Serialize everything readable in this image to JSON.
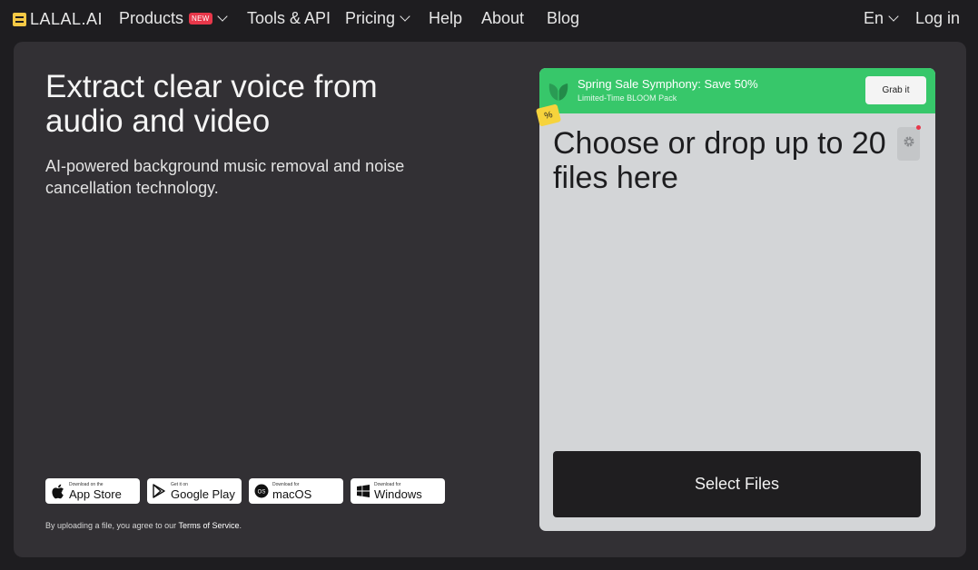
{
  "brand": {
    "name": "LALAL.AI"
  },
  "nav": {
    "products": "Products",
    "products_badge": "NEW",
    "tools": "Tools & API",
    "pricing": "Pricing",
    "help": "Help",
    "about": "About",
    "blog": "Blog",
    "language": "En",
    "login": "Log in"
  },
  "hero": {
    "title": "Extract clear voice from audio and video",
    "subtitle": "AI-powered background music removal and noise cancellation technology."
  },
  "stores": [
    {
      "small": "Download on the",
      "big": "App Store",
      "icon": "apple-icon"
    },
    {
      "small": "Get it on",
      "big": "Google Play",
      "icon": "google-play-icon"
    },
    {
      "small": "Download for",
      "big": "macOS",
      "icon": "macos-icon"
    },
    {
      "small": "Download for",
      "big": "Windows",
      "icon": "windows-icon"
    }
  ],
  "terms": {
    "prefix": "By uploading a file, you agree to our ",
    "link": "Terms of Service",
    "suffix": "."
  },
  "promo": {
    "badge": "%",
    "title": "Spring Sale Symphony: Save 50%",
    "subtitle": "Limited-Time BLOOM Pack",
    "button": "Grab it"
  },
  "upload": {
    "title": "Choose or drop up to 20 files here",
    "button": "Select Files"
  },
  "colors": {
    "background": "#1e1d20",
    "card": "#323034",
    "promo_green": "#37c76a",
    "badge_red": "#e8374a",
    "logo_yellow": "#f6c945",
    "drop_panel": "#d3d5d7",
    "select_button": "#1f1e20"
  }
}
